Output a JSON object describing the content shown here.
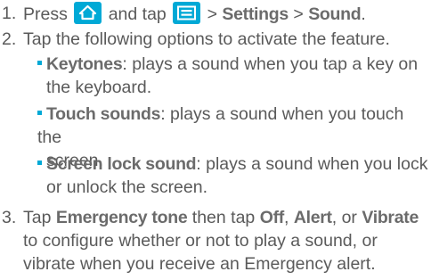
{
  "step1": {
    "number": "1.",
    "press": "Press",
    "and_tap": "and tap",
    "sep1": " > ",
    "settings": "Settings",
    "sep2": " > ",
    "sound": "Sound",
    "period": ".",
    "home_icon": "home-icon",
    "menu_icon": "menu-icon",
    "icon_color": "#00a9d6"
  },
  "step2": {
    "number": "2.",
    "text": "Tap the following options to activate the feature.",
    "items": [
      {
        "term": "Keytones",
        "line1": ": plays a sound when you tap a key on",
        "line2": "the keyboard."
      },
      {
        "term": "Touch sounds",
        "line1": ": plays a sound when you touch the",
        "line2": "screen."
      },
      {
        "term": "Screen lock sound",
        "line1": ": plays a sound when you lock",
        "line2": "or unlock the screen."
      }
    ]
  },
  "step3": {
    "number": "3.",
    "tap": "Tap ",
    "emergency": "Emergency tone",
    "then_tap": " then tap ",
    "off": "Off",
    "comma1": ", ",
    "alert": "Alert",
    "or": ", or ",
    "vibrate": "Vibrate",
    "line2": "to configure whether or not to play a sound, or",
    "line3": "vibrate when you receive an Emergency alert."
  }
}
